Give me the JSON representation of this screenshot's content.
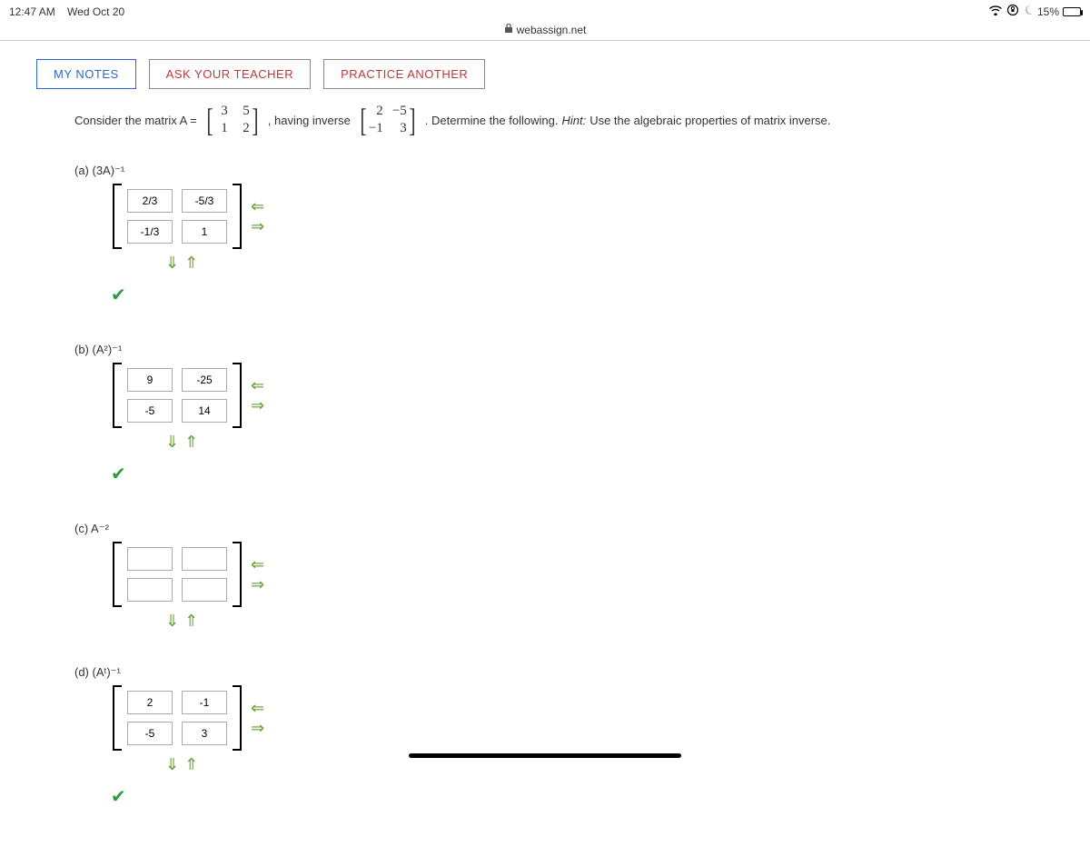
{
  "status": {
    "time": "12:47 AM",
    "date": "Wed Oct 20",
    "battery_percent": "15%",
    "url": "webassign.net"
  },
  "buttons": {
    "my_notes": "MY NOTES",
    "ask_teacher": "ASK YOUR TEACHER",
    "practice": "PRACTICE ANOTHER"
  },
  "prompt": {
    "t1": "Consider the matrix A = ",
    "A": {
      "r1c1": "3",
      "r1c2": "5",
      "r2c1": "1",
      "r2c2": "2"
    },
    "t2": ", having inverse ",
    "Ainv": {
      "r1c1": "2",
      "r1c2": "−5",
      "r2c1": "−1",
      "r2c2": "3"
    },
    "t3": ". Determine the following. ",
    "hint_label": "Hint:",
    "hint_text": " Use the algebraic properties of matrix inverse."
  },
  "parts": {
    "a": {
      "label": "(a)   (3A)⁻¹",
      "m": {
        "r1c1": "2/3",
        "r1c2": "-5/3",
        "r2c1": "-1/3",
        "r2c2": "1"
      }
    },
    "b": {
      "label": "(b)   (A²)⁻¹",
      "m": {
        "r1c1": "9",
        "r1c2": "-25",
        "r2c1": "-5",
        "r2c2": "14"
      }
    },
    "c": {
      "label": "(c)   A⁻²",
      "m": {
        "r1c1": "",
        "r1c2": "",
        "r2c1": "",
        "r2c2": ""
      }
    },
    "d": {
      "label": "(d)   (Aᵗ)⁻¹",
      "m": {
        "r1c1": "2",
        "r1c2": "-1",
        "r2c1": "-5",
        "r2c2": "3"
      }
    }
  },
  "arrows": {
    "left": "⇐",
    "right": "⇒",
    "down": "⇓",
    "up": "⇑"
  }
}
